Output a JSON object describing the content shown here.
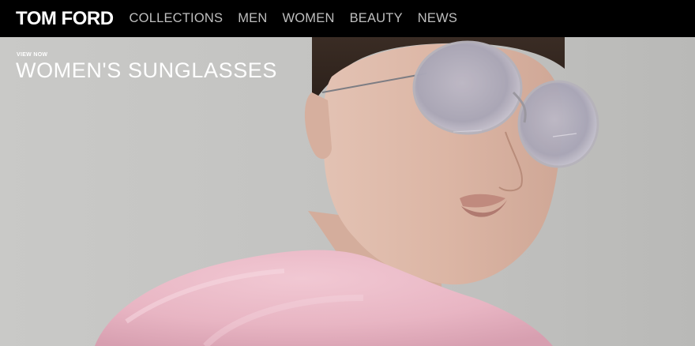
{
  "brand": {
    "logo_text": "TOM FORD"
  },
  "nav": {
    "items": [
      {
        "label": "COLLECTIONS"
      },
      {
        "label": "MEN"
      },
      {
        "label": "WOMEN"
      },
      {
        "label": "BEAUTY"
      },
      {
        "label": "NEWS"
      }
    ]
  },
  "hero": {
    "kicker": "VIEW NOW",
    "title": "WOMEN'S SUNGLASSES"
  },
  "colors": {
    "topbar_background": "#000000",
    "nav_text": "#bfbfbf",
    "hero_background": "#c6c6c4",
    "sweater_pink": "#e9b9c6"
  }
}
